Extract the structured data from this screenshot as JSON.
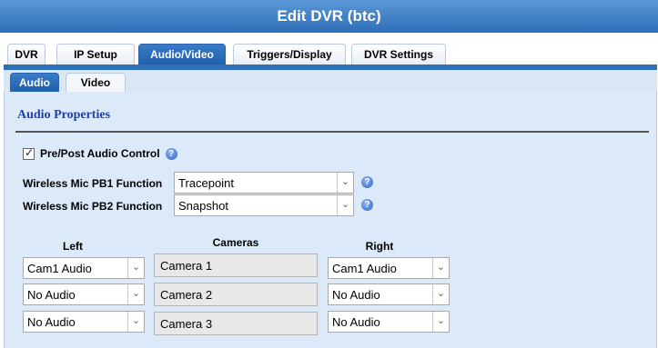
{
  "window": {
    "title": "Edit DVR (btc)"
  },
  "tabs": [
    {
      "label": "DVR"
    },
    {
      "label": "IP Setup"
    },
    {
      "label": "Audio/Video",
      "active": true
    },
    {
      "label": "Triggers/Display"
    },
    {
      "label": "DVR Settings"
    }
  ],
  "subtabs": [
    {
      "label": "Audio",
      "active": true
    },
    {
      "label": "Video"
    }
  ],
  "section": {
    "title": "Audio Properties"
  },
  "prepost": {
    "label": "Pre/Post Audio Control",
    "checked": true,
    "help": "?"
  },
  "pb1": {
    "label": "Wireless Mic PB1 Function",
    "value": "Tracepoint",
    "help": "?"
  },
  "pb2": {
    "label": "Wireless Mic PB2 Function",
    "value": "Snapshot",
    "help": "?"
  },
  "columns": {
    "left": "Left",
    "cameras": "Cameras",
    "right": "Right"
  },
  "rows": [
    {
      "left": "Cam1 Audio",
      "camera": "Camera 1",
      "right": "Cam1 Audio"
    },
    {
      "left": "No Audio",
      "camera": "Camera 2",
      "right": "No Audio"
    },
    {
      "left": "No Audio",
      "camera": "Camera 3",
      "right": "No Audio"
    }
  ],
  "icons": {
    "dropdown": "chevron-down-icon",
    "help": "help-circle-icon",
    "checkbox": "checkmark-icon"
  },
  "colors": {
    "accent": "#2f6fb8",
    "panel": "#dbe9f8",
    "section_title": "#1d3fb0"
  }
}
